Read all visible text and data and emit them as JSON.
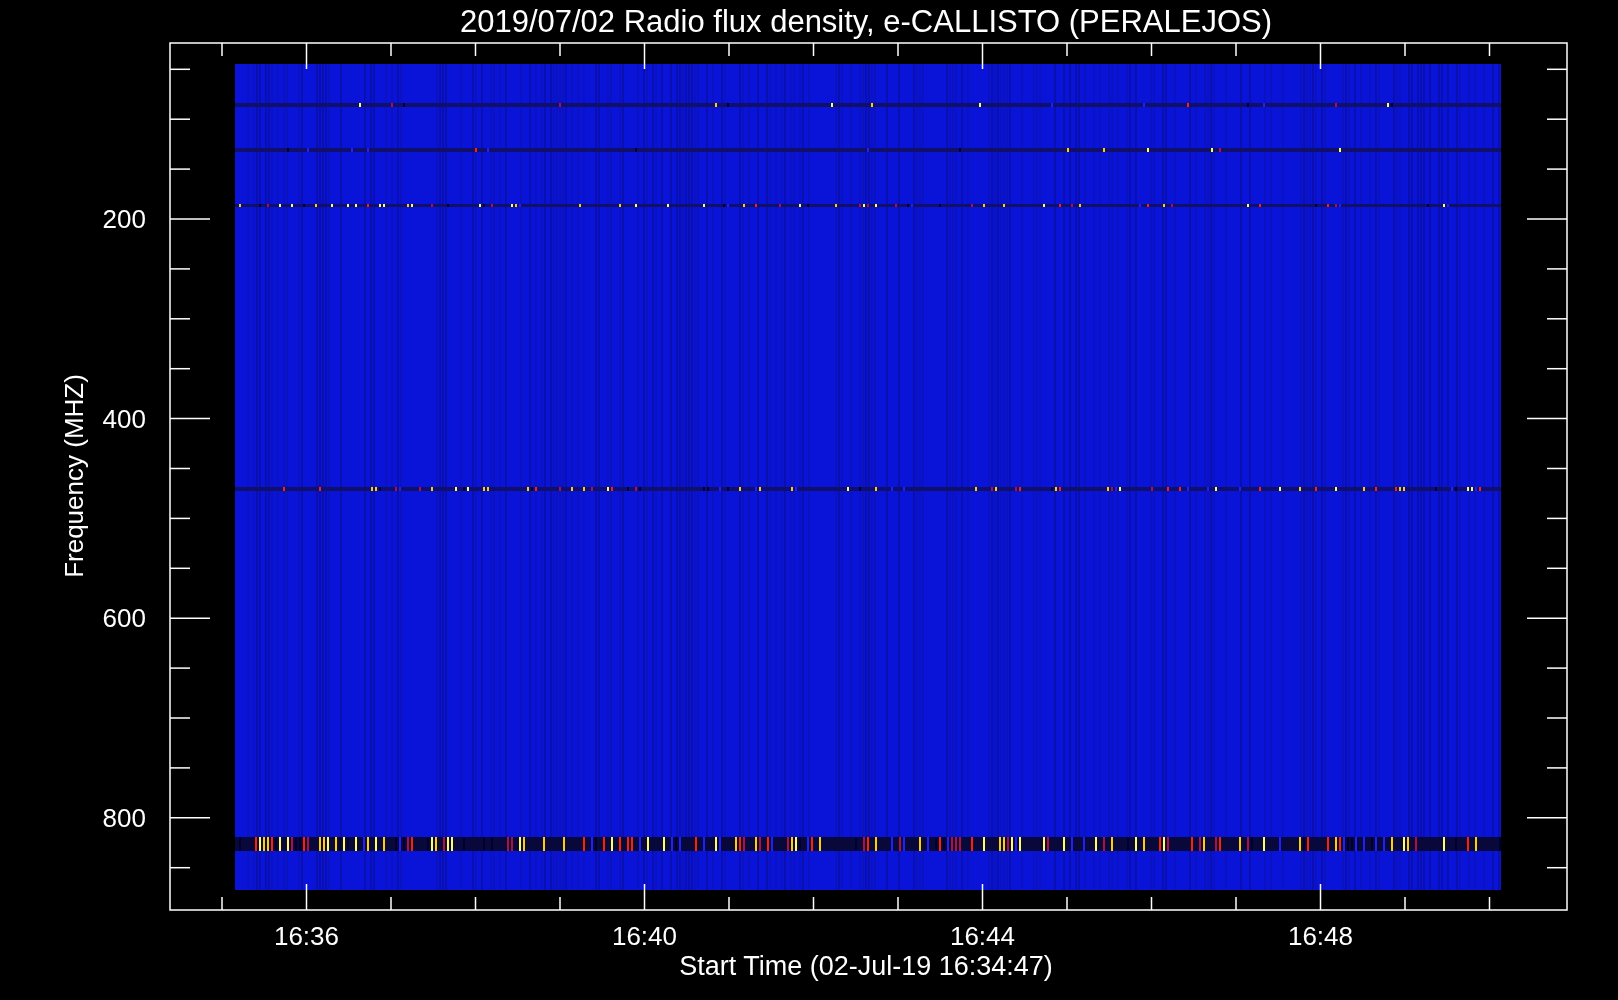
{
  "plot": {
    "title": "2019/07/02  Radio flux density, e-CALLISTO (PERALEJOS)",
    "ylabel": "Frequency (MHZ)",
    "xlabel": "Start Time (02-Jul-19 16:34:47)",
    "yticks": [
      "200",
      "400",
      "600",
      "800"
    ],
    "xticks": [
      "16:36",
      "16:40",
      "16:44",
      "16:48"
    ]
  }
}
